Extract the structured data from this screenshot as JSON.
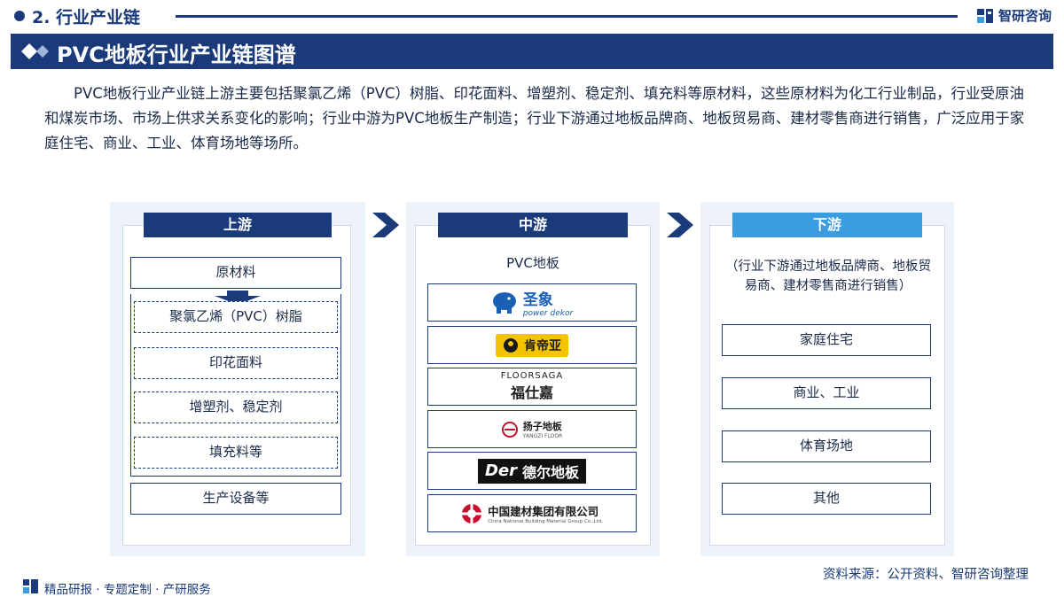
{
  "header": {
    "section_title": "2. 行业产业链",
    "brand": "智研咨询",
    "banner_title": "PVC地板行业产业链图谱"
  },
  "intro": "PVC地板行业产业链上游主要包括聚氯乙烯（PVC）树脂、印花面料、增塑剂、稳定剂、填充料等原材料，这些原材料为化工行业制品，行业受原油和煤炭市场、市场上供求关系变化的影响；行业中游为PVC地板生产制造；行业下游通过地板品牌商、地板贸易商、建材零售商进行销售，广泛应用于家庭住宅、商业、工业、体育场地等场所。",
  "upstream": {
    "title": "上游",
    "raw_materials": "原材料",
    "items": [
      "聚氯乙烯（PVC）树脂",
      "印花面料",
      "增塑剂、稳定剂",
      "填充料等"
    ],
    "equipment": "生产设备等"
  },
  "midstream": {
    "title": "中游",
    "label": "PVC地板",
    "logos": [
      {
        "name": "圣象",
        "sub": "power dekor"
      },
      {
        "name": "肯帝亚",
        "sub": ""
      },
      {
        "name": "福仕嘉",
        "sub": "FLOORSAGA"
      },
      {
        "name": "扬子地板",
        "sub": "YANGZI FLOOR"
      },
      {
        "name": "德尔地板",
        "sub": "Der"
      },
      {
        "name": "中国建材集团有限公司",
        "sub": "China National Building Material Group Co.,Ltd."
      }
    ]
  },
  "downstream": {
    "title": "下游",
    "note": "（行业下游通过地板品牌商、地板贸易商、建材零售商进行销售）",
    "items": [
      "家庭住宅",
      "商业、工业",
      "体育场地",
      "其他"
    ]
  },
  "source": "资料来源：公开资料、智研咨询整理",
  "footer": "精品研报 · 专题定制 · 产研服务",
  "colors": {
    "navy": "#1b3a7a",
    "light_blue": "#3b9de0",
    "panel_bg": "#eef3fa"
  }
}
